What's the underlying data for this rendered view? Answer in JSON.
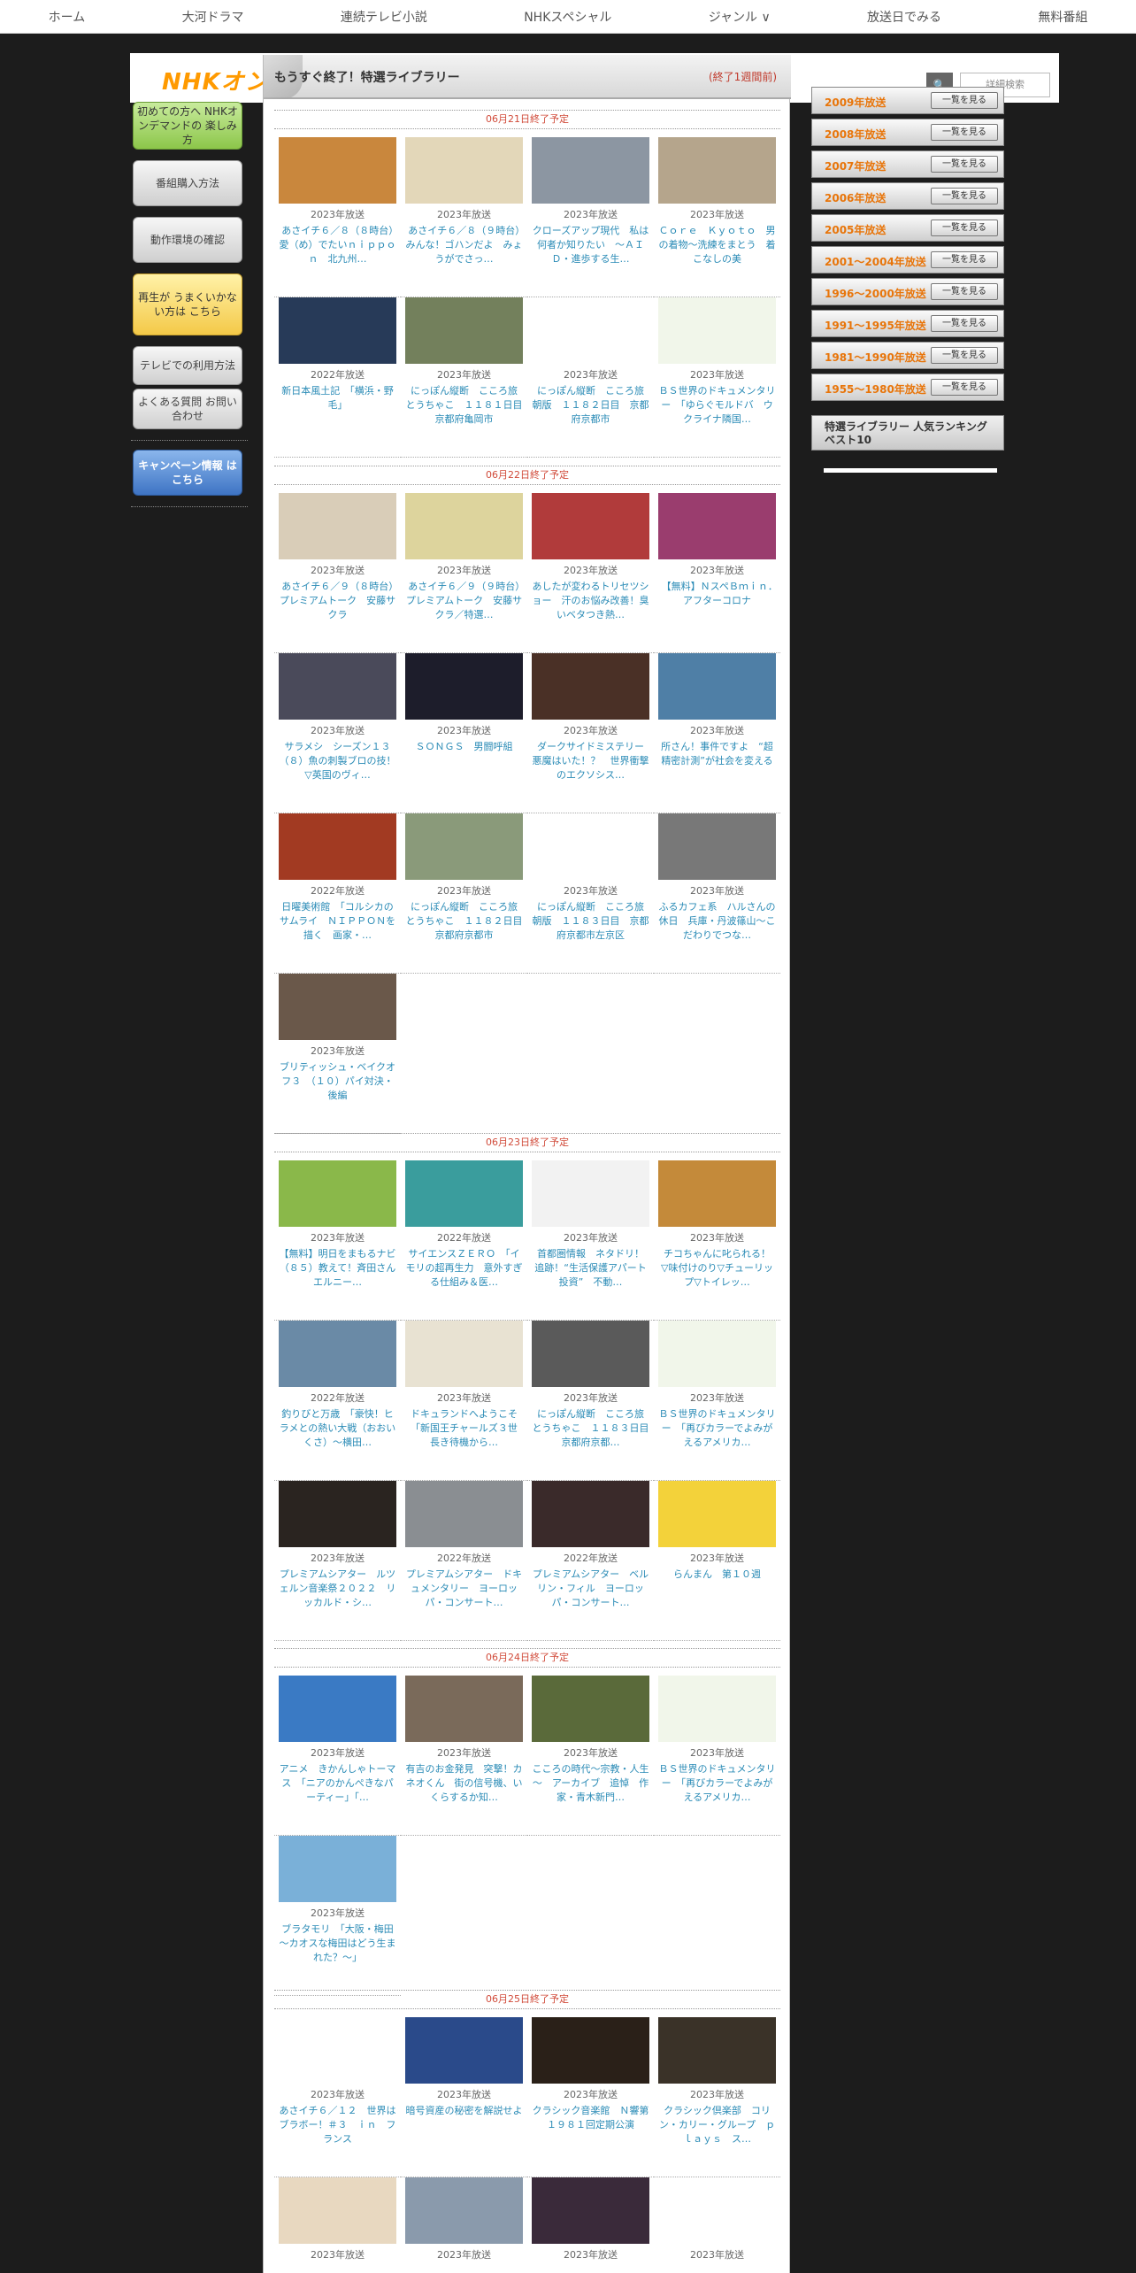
{
  "nav": [
    "ホーム",
    "大河ドラマ",
    "連続テレビ小説",
    "NHKスペシャル",
    "ジャンル ∨",
    "放送日でみる",
    "無料番組"
  ],
  "header": {
    "logo": "NHKオンデマンド",
    "search_placeholder": "詳細検索",
    "search_button": "🔍"
  },
  "left": {
    "beginner": "初めての方へ NHKオンデマンドの 楽しみ方",
    "purchase": "番組購入方法",
    "env": "動作環境の確認",
    "trouble": "再生が うまくいかない方は こちら",
    "tv": "テレビでの利用方法",
    "faq": "よくある質問 お問い合わせ",
    "campaign": "キャンペーン情報 はこちら"
  },
  "main": {
    "title": "もうすぐ終了！特選ライブラリー",
    "subtitle": "(終了1週間前)"
  },
  "sections": [
    {
      "head": "06月21日終了予定",
      "items": [
        {
          "year": "2023年放送",
          "title": "あさイチ６／８（８時台）　愛（め）でたいｎｉｐｐｏｎ　北九州…",
          "color": "#c9873d"
        },
        {
          "year": "2023年放送",
          "title": "あさイチ６／８（９時台）　みんな！ゴハンだよ　みょうがでさっ…",
          "color": "#e3d7b9"
        },
        {
          "year": "2023年放送",
          "title": "クローズアップ現代　私は何者か知りたい　～ＡＩＤ・進歩する生…",
          "color": "#8c96a2"
        },
        {
          "year": "2023年放送",
          "title": "Ｃｏｒｅ　Ｋｙｏｔｏ　男の着物～洗練をまとう　着こなしの美",
          "color": "#b5a58c"
        },
        {
          "year": "2022年放送",
          "title": "新日本風土記　「横浜・野毛」",
          "color": "#273a58"
        },
        {
          "year": "2023年放送",
          "title": "にっぽん縦断　こころ旅　とうちゃこ　１１８１日目　京都府亀岡市",
          "color": "#73805c"
        },
        {
          "year": "2023年放送",
          "title": "にっぽん縦断　こころ旅　朝版　１１８２日目　京都府京都市",
          "color": "#ffffff"
        },
        {
          "year": "2023年放送",
          "title": "ＢＳ世界のドキュメンタリー　「ゆらぐモルドバ　ウクライナ隣国…",
          "color": "#f1f6ea"
        }
      ]
    },
    {
      "head": "06月22日終了予定",
      "items": [
        {
          "year": "2023年放送",
          "title": "あさイチ６／９（８時台）　プレミアムトーク　安藤サクラ",
          "color": "#d9cdb8"
        },
        {
          "year": "2023年放送",
          "title": "あさイチ６／９（９時台）　プレミアムトーク　安藤サクラ／特選…",
          "color": "#ddd49d"
        },
        {
          "year": "2023年放送",
          "title": "あしたが変わるトリセツショー　汗のお悩み改善！臭いベタつき熱…",
          "color": "#b13b3b"
        },
        {
          "year": "2023年放送",
          "title": "【無料】ＮスペＢｍｉｎ．　アフターコロナ",
          "color": "#9a3d6e"
        },
        {
          "year": "2023年放送",
          "title": "サラメシ　シーズン１３　（８）魚の刺製ブロの技！▽英国のヴィ…",
          "color": "#4a4a5a"
        },
        {
          "year": "2023年放送",
          "title": "ＳＯＮＧＳ　男闘呼組",
          "color": "#1d1d2b"
        },
        {
          "year": "2023年放送",
          "title": "ダークサイドミステリー　悪魔はいた！？　世界衝撃のエクソシス…",
          "color": "#4a3026"
        },
        {
          "year": "2023年放送",
          "title": "所さん！事件ですよ　“超精密計測”が社会を変える",
          "color": "#4f7fa6"
        },
        {
          "year": "2022年放送",
          "title": "日曜美術館　「コルシカのサムライ　ＮＩＰＰＯＮを描く　画家・…",
          "color": "#a23a22"
        },
        {
          "year": "2023年放送",
          "title": "にっぽん縦断　こころ旅　とうちゃこ　１１８２日目　京都府京都市",
          "color": "#8a9a7a"
        },
        {
          "year": "2023年放送",
          "title": "にっぽん縦断　こころ旅　朝版　１１８３日目　京都府京都市左京区",
          "color": "#ffffff"
        },
        {
          "year": "2023年放送",
          "title": "ふるカフェ系　ハルさんの休日　兵庫・丹波篠山～こだわりでつな…",
          "color": "#787878"
        },
        {
          "year": "2023年放送",
          "title": "ブリティッシュ・ベイクオフ３　（１０）パイ対決・後編",
          "color": "#6a584a"
        }
      ]
    },
    {
      "head": "06月23日終了予定",
      "items": [
        {
          "year": "2023年放送",
          "title": "【無料】明日をまもるナビ　（８５）教えて！斉田さん　エルニー…",
          "color": "#8ab84a"
        },
        {
          "year": "2022年放送",
          "title": "サイエンスＺＥＲＯ　「イモリの超再生力　意外すぎる仕組み＆医…",
          "color": "#3a9d9d"
        },
        {
          "year": "2023年放送",
          "title": "首都圏情報　ネタドリ！　追跡！“生活保護アパート投資”　不動…",
          "color": "#f2f2f2"
        },
        {
          "year": "2023年放送",
          "title": "チコちゃんに叱られる！　▽味付けのり▽チューリップ▽トイレッ…",
          "color": "#c48a3a"
        },
        {
          "year": "2022年放送",
          "title": "釣りびと万歳　「豪快！ヒラメとの熱い大戦（おおいくさ）～横田…",
          "color": "#6a8aa6"
        },
        {
          "year": "2023年放送",
          "title": "ドキュランドへようこそ　「新国王チャールズ３世　長き待機から…",
          "color": "#e8e2d2"
        },
        {
          "year": "2023年放送",
          "title": "にっぽん縦断　こころ旅　とうちゃこ　１１８３日目　京都府京都…",
          "color": "#5a5a5a"
        },
        {
          "year": "2023年放送",
          "title": "ＢＳ世界のドキュメンタリー　「再びカラーでよみがえるアメリカ…",
          "color": "#f1f6ea"
        },
        {
          "year": "2023年放送",
          "title": "プレミアムシアター　ルツェルン音楽祭２０２２　リッカルド・シ…",
          "color": "#2a2420"
        },
        {
          "year": "2022年放送",
          "title": "プレミアムシアター　ドキュメンタリー　ヨーロッパ・コンサート…",
          "color": "#8a8e92"
        },
        {
          "year": "2022年放送",
          "title": "プレミアムシアター　ベルリン・フィル　ヨーロッパ・コンサート…",
          "color": "#3a2a2a"
        },
        {
          "year": "2023年放送",
          "title": "らんまん　第１０週",
          "color": "#f3d23a"
        }
      ]
    },
    {
      "head": "06月24日終了予定",
      "items": [
        {
          "year": "2023年放送",
          "title": "アニメ　きかんしゃトーマス　「ニアのかんぺきなパーティー」「…",
          "color": "#3a7ac4"
        },
        {
          "year": "2023年放送",
          "title": "有吉のお金発見　突撃！カネオくん　街の信号機、いくらするか知…",
          "color": "#7a6a5a"
        },
        {
          "year": "2023年放送",
          "title": "こころの時代～宗教・人生～　アーカイブ　追悼　作家・青木新門…",
          "color": "#5a6a3a"
        },
        {
          "year": "2023年放送",
          "title": "ＢＳ世界のドキュメンタリー　「再びカラーでよみがえるアメリカ…",
          "color": "#f1f6ea"
        },
        {
          "year": "2023年放送",
          "title": "ブラタモリ　「大阪・梅田～カオスな梅田はどう生まれた？～」",
          "color": "#7ab0d8"
        }
      ]
    },
    {
      "head": "06月25日終了予定",
      "items": [
        {
          "year": "2023年放送",
          "title": "あさイチ６／１２　世界はブラボー！＃３　ｉｎ　フランス",
          "color": "#ffffff"
        },
        {
          "year": "2023年放送",
          "title": "暗号資産の秘密を解説せよ",
          "color": "#2a4a8a"
        },
        {
          "year": "2023年放送",
          "title": "クラシック音楽館　Ｎ響第１９８１回定期公演",
          "color": "#2a2018"
        },
        {
          "year": "2023年放送",
          "title": "クラシック倶楽部　コリン・カリー・グループ　ｐｌａｙｓ　ス…",
          "color": "#3a3228"
        },
        {
          "year": "2023年放送",
          "title": "",
          "color": "#e8d8c0"
        },
        {
          "year": "2023年放送",
          "title": "",
          "color": "#8a9aac"
        },
        {
          "year": "2023年放送",
          "title": "",
          "color": "#3a2a3a"
        },
        {
          "year": "2023年放送",
          "title": "",
          "color": "#ffffff"
        }
      ]
    }
  ],
  "years": [
    "2009年放送",
    "2008年放送",
    "2007年放送",
    "2006年放送",
    "2005年放送",
    "2001～2004年放送",
    "1996～2000年放送",
    "1991～1995年放送",
    "1981～1990年放送",
    "1955～1980年放送"
  ],
  "year_button": "一覧を見る",
  "ranking": "特選ライブラリー 人気ランキングベスト10"
}
